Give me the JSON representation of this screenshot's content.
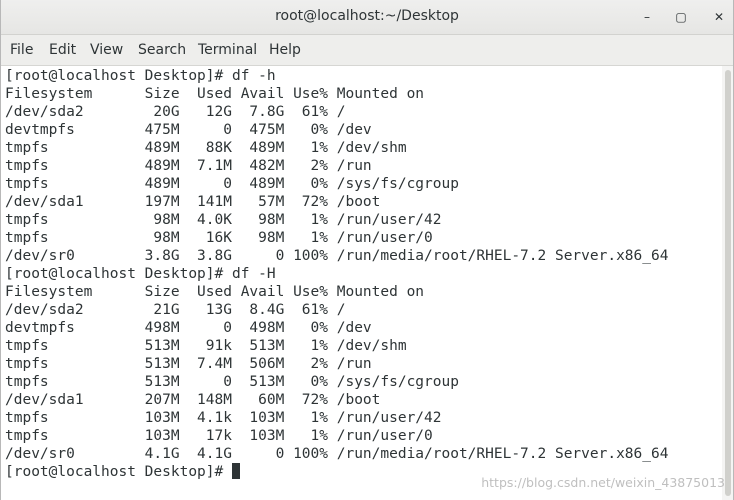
{
  "window": {
    "title": "root@localhost:~/Desktop",
    "minimize_glyph": "–",
    "maximize_glyph": "▢",
    "close_glyph": "✕"
  },
  "menu": {
    "items": [
      "File",
      "Edit",
      "View",
      "Search",
      "Terminal",
      "Help"
    ]
  },
  "terminal": {
    "lines": [
      "[root@localhost Desktop]# df -h",
      "Filesystem      Size  Used Avail Use% Mounted on",
      "/dev/sda2        20G   12G  7.8G  61% /",
      "devtmpfs        475M     0  475M   0% /dev",
      "tmpfs           489M   88K  489M   1% /dev/shm",
      "tmpfs           489M  7.1M  482M   2% /run",
      "tmpfs           489M     0  489M   0% /sys/fs/cgroup",
      "/dev/sda1       197M  141M   57M  72% /boot",
      "tmpfs            98M  4.0K   98M   1% /run/user/42",
      "tmpfs            98M   16K   98M   1% /run/user/0",
      "/dev/sr0        3.8G  3.8G     0 100% /run/media/root/RHEL-7.2 Server.x86_64",
      "[root@localhost Desktop]# df -H",
      "Filesystem      Size  Used Avail Use% Mounted on",
      "/dev/sda2        21G   13G  8.4G  61% /",
      "devtmpfs        498M     0  498M   0% /dev",
      "tmpfs           513M   91k  513M   1% /dev/shm",
      "tmpfs           513M  7.4M  506M   2% /run",
      "tmpfs           513M     0  513M   0% /sys/fs/cgroup",
      "/dev/sda1       207M  148M   60M  72% /boot",
      "tmpfs           103M  4.1k  103M   1% /run/user/42",
      "tmpfs           103M   17k  103M   1% /run/user/0",
      "/dev/sr0        4.1G  4.1G     0 100% /run/media/root/RHEL-7.2 Server.x86_64"
    ],
    "prompt": "[root@localhost Desktop]# "
  },
  "watermark": "https://blog.csdn.net/weixin_43875013"
}
